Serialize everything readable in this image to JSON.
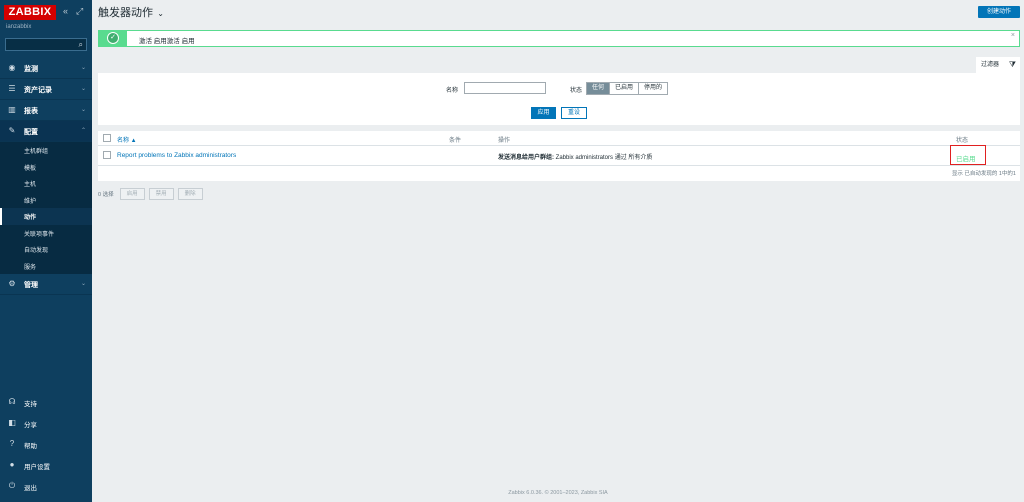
{
  "sidebar": {
    "logo": "ZABBIX",
    "collapse_icon": "«",
    "kiosk_icon": "⤢",
    "server_name": "ianzabbix",
    "search_placeholder": "",
    "menu": [
      {
        "label": "监测",
        "icon": "eye-icon",
        "glyph": "◉"
      },
      {
        "label": "资产记录",
        "icon": "list-icon",
        "glyph": "☰"
      },
      {
        "label": "报表",
        "icon": "chart-icon",
        "glyph": "▥"
      },
      {
        "label": "配置",
        "icon": "wrench-icon",
        "glyph": "🔧"
      }
    ],
    "submenu": [
      "主机群组",
      "模板",
      "主机",
      "维护",
      "动作",
      "关联项事件",
      "自动发现",
      "服务"
    ],
    "admin": {
      "label": "管理",
      "icon": "gear-icon",
      "glyph": "⚙"
    },
    "bottom": [
      {
        "label": "支持",
        "icon": "headset-icon",
        "glyph": "☊"
      },
      {
        "label": "分享",
        "icon": "share-icon",
        "glyph": "◧"
      },
      {
        "label": "帮助",
        "icon": "help-icon",
        "glyph": "?"
      },
      {
        "label": "用户设置",
        "icon": "user-icon",
        "glyph": "●"
      },
      {
        "label": "退出",
        "icon": "power-icon",
        "glyph": "⏻"
      }
    ]
  },
  "header": {
    "title": "触发器动作",
    "create_button": "创建动作"
  },
  "message": {
    "text": "激活 启用激活 启用",
    "close": "×"
  },
  "filter": {
    "tab_label": "过滤器",
    "name_label": "名称",
    "name_value": "",
    "status_label": "状态",
    "status_options": [
      "任何",
      "已启用",
      "停用的"
    ],
    "status_selected": "任何",
    "apply": "应用",
    "reset": "重设"
  },
  "table": {
    "columns": {
      "name": "名称 ▲",
      "conditions": "条件",
      "operations": "操作",
      "status": "状态"
    },
    "rows": [
      {
        "name": "Report problems to Zabbix administrators",
        "conditions": "",
        "operations_bold": "发送消息给用户群组:",
        "operations_rest": " Zabbix administrators 通过 所有介质",
        "status": "已启用"
      }
    ],
    "displayed": "显示 已自动发现的 1中的1"
  },
  "mass": {
    "selected": "0 选择",
    "buttons": [
      "启用",
      "禁用",
      "删除"
    ]
  },
  "footer": "Zabbix 6.0.36. © 2001–2023, Zabbix SIA"
}
